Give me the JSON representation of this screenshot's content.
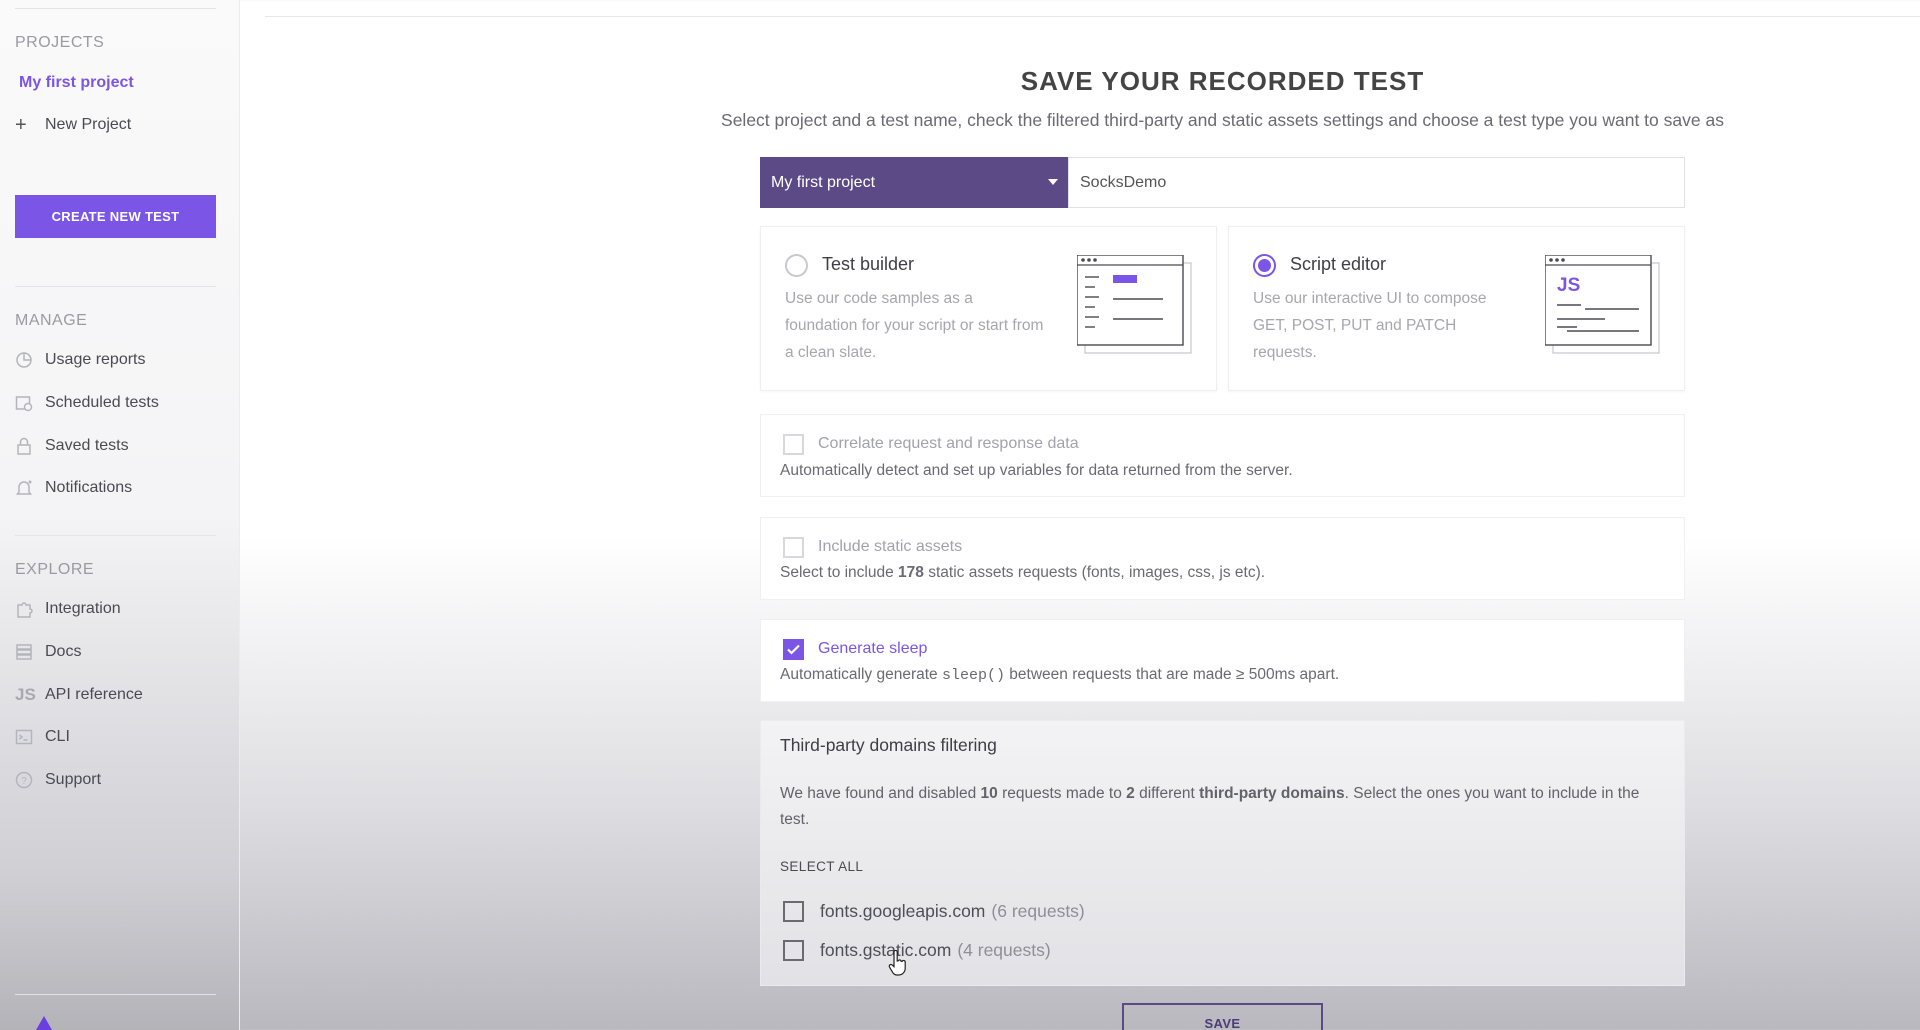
{
  "sidebar": {
    "projects_heading": "PROJECTS",
    "active_project": "My first project",
    "new_project": "New Project",
    "create_button": "CREATE NEW TEST",
    "manage_heading": "MANAGE",
    "manage_items": [
      {
        "label": "Usage reports",
        "icon": "pie-chart-icon"
      },
      {
        "label": "Scheduled tests",
        "icon": "calendar-clock-icon"
      },
      {
        "label": "Saved tests",
        "icon": "lock-icon"
      },
      {
        "label": "Notifications",
        "icon": "bell-icon"
      }
    ],
    "explore_heading": "EXPLORE",
    "explore_items": [
      {
        "label": "Integration",
        "icon": "puzzle-icon"
      },
      {
        "label": "Docs",
        "icon": "docs-icon"
      },
      {
        "label": "API reference",
        "icon": "js-icon"
      },
      {
        "label": "CLI",
        "icon": "terminal-icon"
      },
      {
        "label": "Support",
        "icon": "help-circle-icon"
      }
    ]
  },
  "main": {
    "title": "SAVE YOUR RECORDED TEST",
    "subtitle": "Select project and a test name, check the filtered third-party and static assets settings and choose a test type you want to save as",
    "project_select": "My first project",
    "test_name_value": "SocksDemo",
    "test_types": [
      {
        "title": "Test builder",
        "description": "Use our code samples as a foundation for your script or start from a clean slate.",
        "selected": false
      },
      {
        "title": "Script editor",
        "description": "Use our interactive UI to compose GET, POST, PUT and PATCH requests.",
        "selected": true,
        "illustration_label": "JS"
      }
    ],
    "options": {
      "correlate": {
        "label": "Correlate request and response data",
        "description": "Automatically detect and set up variables for data returned from the server.",
        "checked": false
      },
      "static_assets": {
        "label": "Include static assets",
        "desc_before": "Select to include ",
        "count": "178",
        "desc_after": " static assets requests (fonts, images, css, js etc).",
        "checked": false
      },
      "sleep": {
        "label": "Generate sleep",
        "desc_before": "Automatically generate ",
        "code": "sleep()",
        "desc_after": " between requests that are made ≥ 500ms apart.",
        "checked": true
      }
    },
    "third_party": {
      "heading": "Third-party domains filtering",
      "p1": "We have found and disabled ",
      "req_count": "10",
      "p2": " requests made to ",
      "domain_count": "2",
      "p3": " different ",
      "p_bold": "third-party domains",
      "p4": ". Select the ones you want to include in the test.",
      "select_all": "SELECT ALL",
      "domains": [
        {
          "name": "fonts.googleapis.com",
          "count": "(6 requests)",
          "checked": false
        },
        {
          "name": "fonts.gstatic.com",
          "count": "(4 requests)",
          "checked": false
        }
      ]
    },
    "save_button": "SAVE"
  },
  "colors": {
    "accent": "#7b55e6",
    "select_bg": "#5b4a86"
  }
}
